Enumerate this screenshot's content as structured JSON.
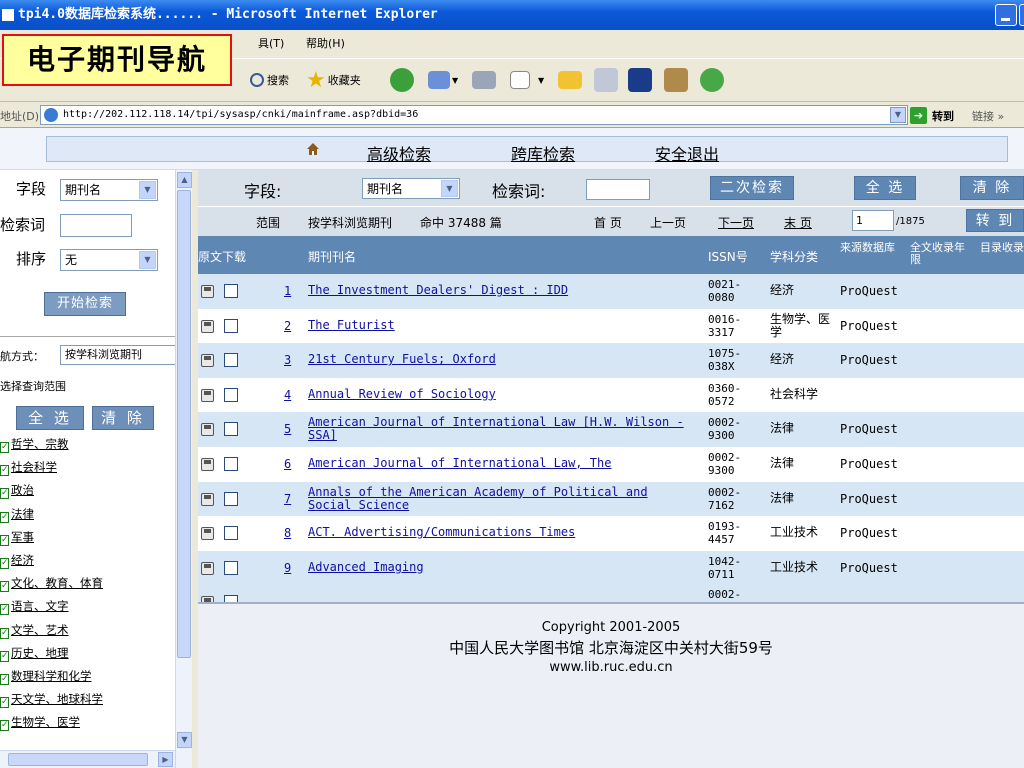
{
  "window": {
    "title": "tpi4.0数据库检索系统...... - Microsoft Internet Explorer"
  },
  "menu": {
    "tools": "具(T)",
    "help": "帮助(H)"
  },
  "toolbar": {
    "search": "搜索",
    "favorites": "收藏夹"
  },
  "address": {
    "label": "地址(D)",
    "url": "http://202.112.118.14/tpi/sysasp/cnki/mainframe.asp?dbid=36",
    "go": "转到",
    "links": "链接 »"
  },
  "overlay": {
    "label": "电子期刊导航"
  },
  "nav": {
    "advanced": "高级检索",
    "cross": "跨库检索",
    "logout": "安全退出"
  },
  "left": {
    "field_label": "字段",
    "field_value": "期刊名",
    "keyword_label": "检索词",
    "keyword_value": "",
    "sort_label": "排序",
    "sort_value": "无",
    "search_btn": "开始检索",
    "nav_mode_label": "航方式：",
    "nav_mode_value": "按学科浏览期刊",
    "scope_label": "选择查询范围",
    "select_all": "全 选",
    "clear": "清 除",
    "categories": [
      "哲学、宗教",
      "社会科学",
      "政治",
      "法律",
      "军事",
      "经济",
      "文化、教育、体育",
      "语言、文字",
      "文学、艺术",
      "历史、地理",
      "数理科学和化学",
      "天文学、地球科学",
      "生物学、医学"
    ]
  },
  "search": {
    "field_label": "字段:",
    "field_value": "期刊名",
    "keyword_label": "检索词:",
    "keyword_value": "",
    "second": "二次检索",
    "select_all": "全 选",
    "clear": "清 除"
  },
  "paging": {
    "scope_label": "范围",
    "scope_value": "按学科浏览期刊",
    "hits": "命中 37488 篇",
    "first": "首 页",
    "prev": "上一页",
    "next": "下一页",
    "last": "末 页",
    "page": "1",
    "total": "/1875",
    "goto": "转 到"
  },
  "table": {
    "headers": {
      "download": "原文下载",
      "name": "期刊刊名",
      "issn": "ISSN号",
      "subject": "学科分类",
      "source": "来源数据库",
      "fulltext": "全文收录年限",
      "catalog": "目录收录年限"
    },
    "rows": [
      {
        "no": "1",
        "name": [
          "The Investment Dealers' Digest : IDD"
        ],
        "issn": [
          "0021-",
          "0080"
        ],
        "subject": [
          "经济"
        ],
        "source": "ProQuest"
      },
      {
        "no": "2",
        "name": [
          "The Futurist"
        ],
        "issn": [
          "0016-",
          "3317"
        ],
        "subject": [
          "生物学、医",
          "学"
        ],
        "source": "ProQuest"
      },
      {
        "no": "3",
        "name": [
          "21st Century Fuels; Oxford"
        ],
        "issn": [
          "1075-",
          "038X"
        ],
        "subject": [
          "经济"
        ],
        "source": "ProQuest"
      },
      {
        "no": "4",
        "name": [
          "Annual Review of Sociology"
        ],
        "issn": [
          "0360-",
          "0572"
        ],
        "subject": [
          "社会科学"
        ],
        "source": ""
      },
      {
        "no": "5",
        "name": [
          "American Journal of International Law [H.W. Wilson -",
          "SSA]"
        ],
        "issn": [
          "0002-",
          "9300"
        ],
        "subject": [
          "法律"
        ],
        "source": "ProQuest"
      },
      {
        "no": "6",
        "name": [
          "American Journal of International Law, The"
        ],
        "issn": [
          "0002-",
          "9300"
        ],
        "subject": [
          "法律"
        ],
        "source": "ProQuest"
      },
      {
        "no": "7",
        "name": [
          "Annals of the American Academy of Political and",
          "Social Science"
        ],
        "issn": [
          "0002-",
          "7162"
        ],
        "subject": [
          "法律"
        ],
        "source": "ProQuest"
      },
      {
        "no": "8",
        "name": [
          "ACT. Advertising/Communications Times"
        ],
        "issn": [
          "0193-",
          "4457"
        ],
        "subject": [
          "工业技术"
        ],
        "source": "ProQuest"
      },
      {
        "no": "9",
        "name": [
          "Advanced Imaging"
        ],
        "issn": [
          "1042-",
          "0711"
        ],
        "subject": [
          "工业技术"
        ],
        "source": "ProQuest"
      }
    ],
    "partial_row": {
      "issn": "0002-"
    }
  },
  "footer": {
    "copyright": "Copyright 2001-2005",
    "org": "中国人民大学图书馆  北京海淀区中关村大街59号",
    "site": "www.lib.ruc.edu.cn"
  },
  "colors": {
    "header_bg": "#5f87b4",
    "row_alt": "#d6e6f4",
    "overlay_border": "#e01010",
    "overlay_bg": "#ffff9d"
  }
}
